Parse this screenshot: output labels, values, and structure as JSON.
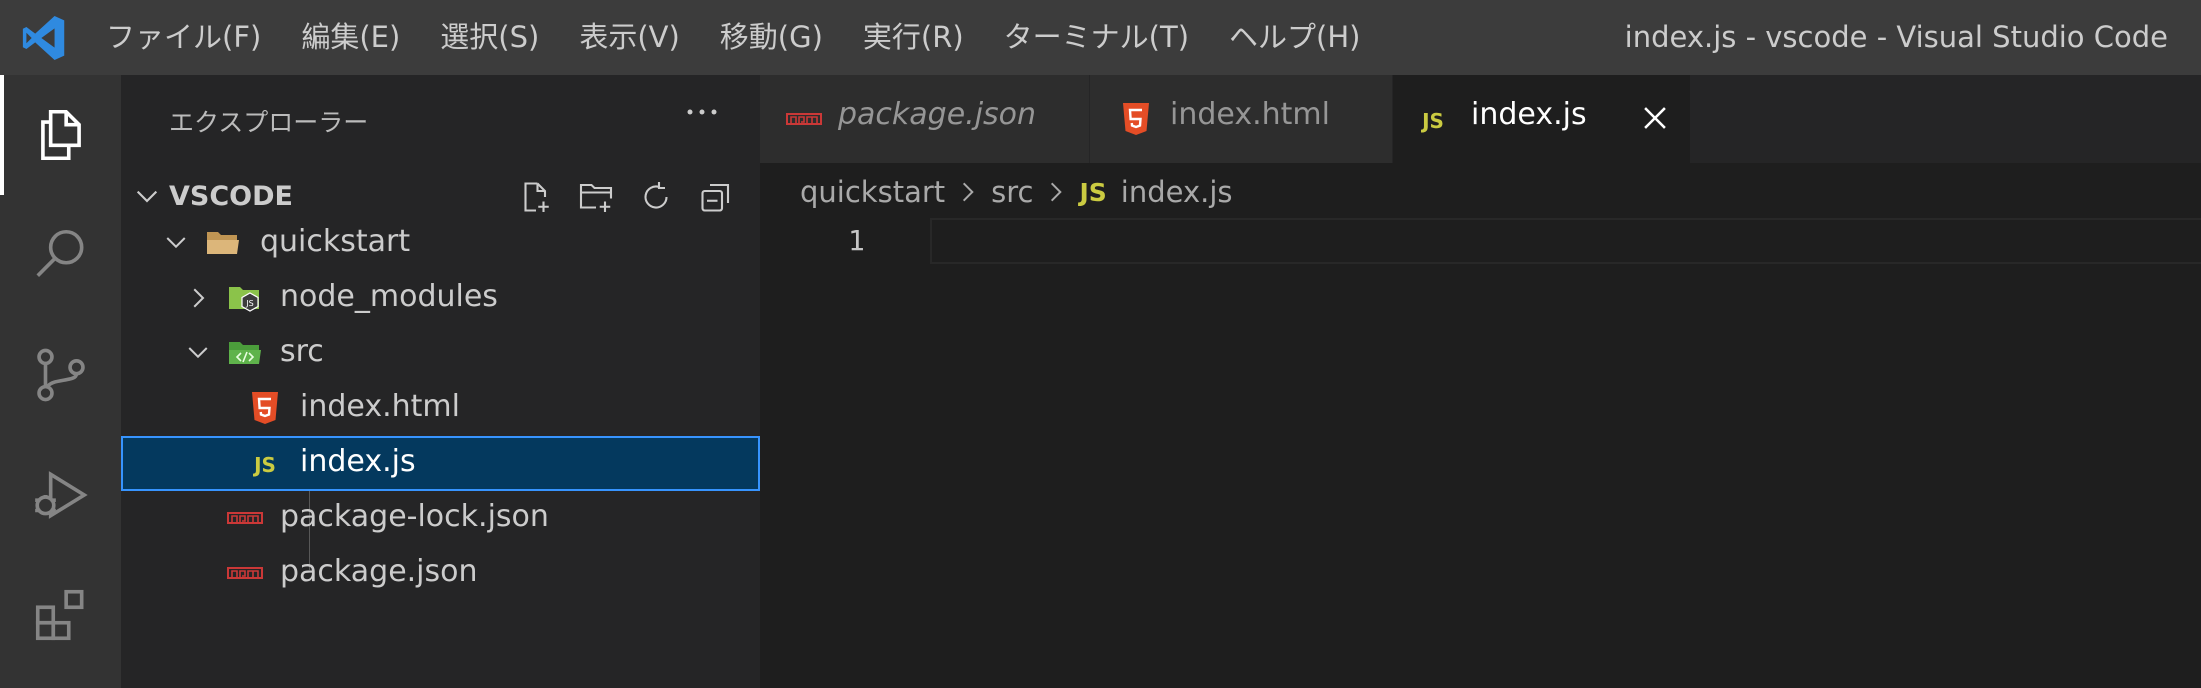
{
  "titlebar": {
    "logo_icon": "vscode-logo-icon",
    "menu": [
      "ファイル(F)",
      "編集(E)",
      "選択(S)",
      "表示(V)",
      "移動(G)",
      "実行(R)",
      "ターミナル(T)",
      "ヘルプ(H)"
    ],
    "window_title": "index.js - vscode - Visual Studio Code"
  },
  "activitybar": {
    "items": [
      {
        "icon": "explorer-icon",
        "active": true
      },
      {
        "icon": "search-icon"
      },
      {
        "icon": "source-control-icon"
      },
      {
        "icon": "run-debug-icon"
      },
      {
        "icon": "extensions-icon"
      }
    ]
  },
  "sidebar": {
    "title": "エクスプローラー",
    "more_icon": "ellipsis-icon",
    "folder": "VSCODE",
    "header_actions": [
      "new-file-icon",
      "new-folder-icon",
      "refresh-icon",
      "collapse-all-icon"
    ],
    "tree": [
      {
        "label": "quickstart",
        "type": "folder",
        "expanded": true
      },
      {
        "label": "node_modules",
        "type": "folder",
        "expanded": false
      },
      {
        "label": "src",
        "type": "folder",
        "expanded": true
      },
      {
        "label": "index.html",
        "type": "html"
      },
      {
        "label": "index.js",
        "type": "js",
        "selected": true
      },
      {
        "label": "package-lock.json",
        "type": "npm"
      },
      {
        "label": "package.json",
        "type": "npm"
      }
    ]
  },
  "tabs": [
    {
      "label": "package.json",
      "icon": "npm-icon",
      "preview": true
    },
    {
      "label": "index.html",
      "icon": "html5-icon"
    },
    {
      "label": "index.js",
      "icon": "js-icon",
      "active": true,
      "close_icon": "close-icon"
    }
  ],
  "breadcrumb": {
    "parts": [
      "quickstart",
      "src",
      "index.js"
    ],
    "js_badge": "JS"
  },
  "editor": {
    "line_numbers": [
      "1"
    ]
  },
  "colors": {
    "titlebar": "#3c3c3c",
    "activitybar": "#333333",
    "sidebar": "#252526",
    "editor": "#1e1e1e",
    "selection": "#04395e",
    "focus_border": "#3794ff",
    "js_yellow": "#cbcb41",
    "html_orange": "#e44d26",
    "npm_red": "#cb3837"
  }
}
